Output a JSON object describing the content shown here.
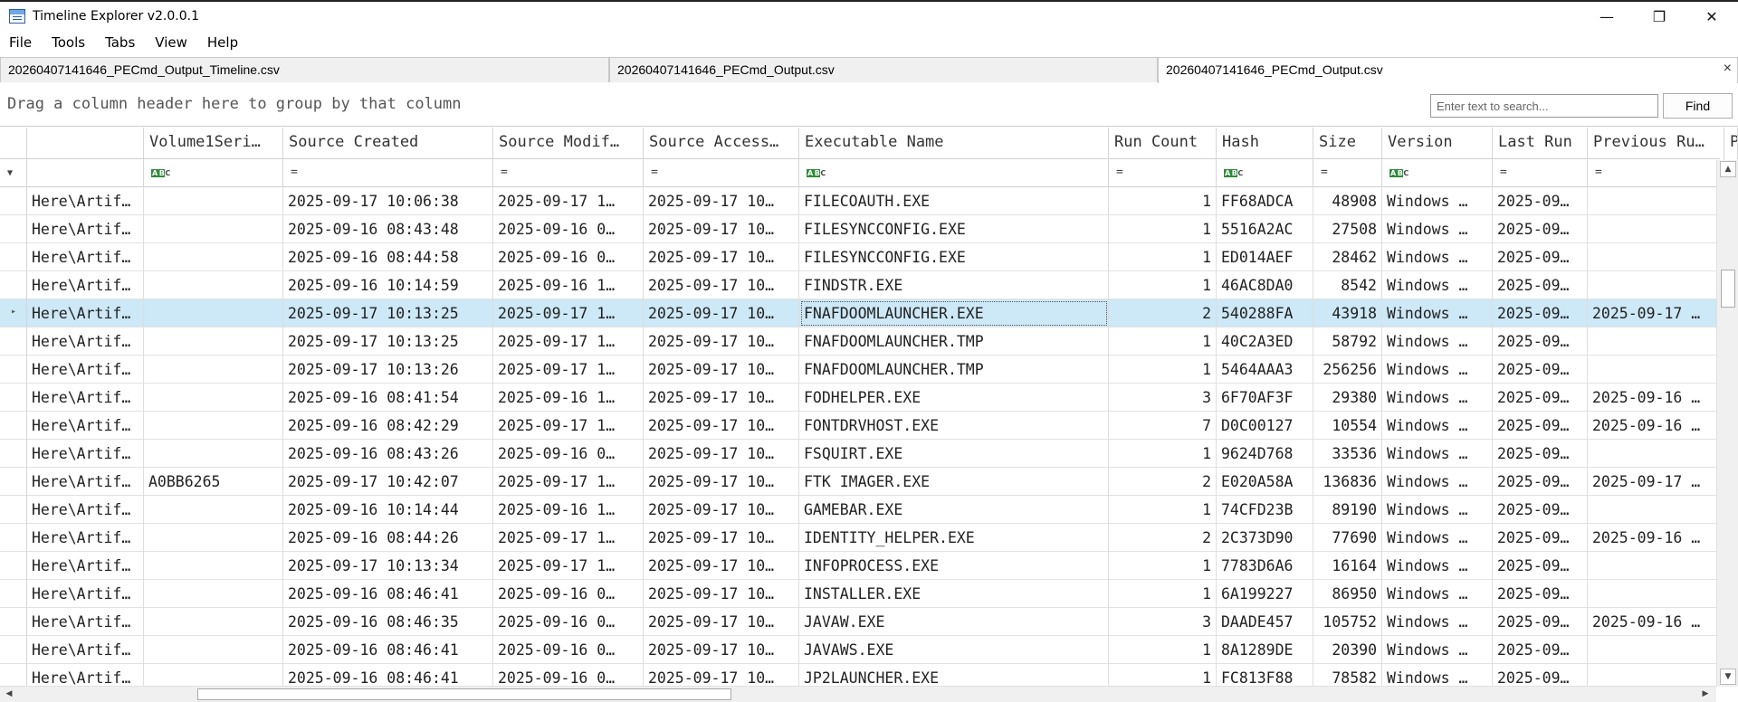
{
  "window": {
    "title": "Timeline Explorer v2.0.0.1",
    "minimize": "—",
    "restore": "❐",
    "close": "✕"
  },
  "menu": [
    "File",
    "Tools",
    "Tabs",
    "View",
    "Help"
  ],
  "tabs": [
    {
      "label": "20260407141646_PECmd_Output_Timeline.csv",
      "active": false
    },
    {
      "label": "20260407141646_PECmd_Output.csv",
      "active": false
    },
    {
      "label": "20260407141646_PECmd_Output.csv",
      "active": true
    }
  ],
  "tab_close": "×",
  "group_panel": {
    "hint": "Drag a column header here to group by that column",
    "search_placeholder": "Enter text to search...",
    "find_label": "Find"
  },
  "columns": [
    {
      "label": "",
      "filter": "",
      "type": "text"
    },
    {
      "label": "Volume1Seri…",
      "filter": "abc",
      "type": "text"
    },
    {
      "label": "Source Created",
      "filter": "=",
      "type": "date"
    },
    {
      "label": "Source Modif…",
      "filter": "=",
      "type": "date"
    },
    {
      "label": "Source Access…",
      "filter": "=",
      "type": "date"
    },
    {
      "label": "Executable Name",
      "filter": "abc",
      "type": "text"
    },
    {
      "label": "Run Count",
      "filter": "=",
      "type": "num"
    },
    {
      "label": "Hash",
      "filter": "abc",
      "type": "text"
    },
    {
      "label": "Size",
      "filter": "=",
      "type": "num"
    },
    {
      "label": "Version",
      "filter": "abc",
      "type": "text"
    },
    {
      "label": "Last Run",
      "filter": "=",
      "type": "date"
    },
    {
      "label": "Previous Ru…",
      "filter": "=",
      "type": "date"
    },
    {
      "label": "P",
      "filter": "",
      "type": "date"
    }
  ],
  "rows": [
    {
      "selected": false,
      "cells": [
        "Here\\Artif…",
        "",
        "2025-09-17 10:06:38",
        "2025-09-17 1…",
        "2025-09-17 10…",
        "FILECOAUTH.EXE",
        "1",
        "FF68ADCA",
        "48908",
        "Windows …",
        "2025-09…",
        "",
        ""
      ]
    },
    {
      "selected": false,
      "cells": [
        "Here\\Artif…",
        "",
        "2025-09-16 08:43:48",
        "2025-09-16 0…",
        "2025-09-17 10…",
        "FILESYNCCONFIG.EXE",
        "1",
        "5516A2AC",
        "27508",
        "Windows …",
        "2025-09…",
        "",
        ""
      ]
    },
    {
      "selected": false,
      "cells": [
        "Here\\Artif…",
        "",
        "2025-09-16 08:44:58",
        "2025-09-16 0…",
        "2025-09-17 10…",
        "FILESYNCCONFIG.EXE",
        "1",
        "ED014AEF",
        "28462",
        "Windows …",
        "2025-09…",
        "",
        ""
      ]
    },
    {
      "selected": false,
      "cells": [
        "Here\\Artif…",
        "",
        "2025-09-16 10:14:59",
        "2025-09-16 1…",
        "2025-09-17 10…",
        "FINDSTR.EXE",
        "1",
        "46AC8DA0",
        "8542",
        "Windows …",
        "2025-09…",
        "",
        ""
      ]
    },
    {
      "selected": true,
      "cells": [
        "Here\\Artif…",
        "",
        "2025-09-17 10:13:25",
        "2025-09-17 1…",
        "2025-09-17 10…",
        "FNAFDOOMLAUNCHER.EXE",
        "2",
        "540288FA",
        "43918",
        "Windows …",
        "2025-09…",
        "2025-09-17 …",
        ""
      ]
    },
    {
      "selected": false,
      "cells": [
        "Here\\Artif…",
        "",
        "2025-09-17 10:13:25",
        "2025-09-17 1…",
        "2025-09-17 10…",
        "FNAFDOOMLAUNCHER.TMP",
        "1",
        "40C2A3ED",
        "58792",
        "Windows …",
        "2025-09…",
        "",
        ""
      ]
    },
    {
      "selected": false,
      "cells": [
        "Here\\Artif…",
        "",
        "2025-09-17 10:13:26",
        "2025-09-17 1…",
        "2025-09-17 10…",
        "FNAFDOOMLAUNCHER.TMP",
        "1",
        "5464AAA3",
        "256256",
        "Windows …",
        "2025-09…",
        "",
        ""
      ]
    },
    {
      "selected": false,
      "cells": [
        "Here\\Artif…",
        "",
        "2025-09-16 08:41:54",
        "2025-09-16 1…",
        "2025-09-17 10…",
        "FODHELPER.EXE",
        "3",
        "6F70AF3F",
        "29380",
        "Windows …",
        "2025-09…",
        "2025-09-16 …",
        ""
      ]
    },
    {
      "selected": false,
      "cells": [
        "Here\\Artif…",
        "",
        "2025-09-16 08:42:29",
        "2025-09-17 1…",
        "2025-09-17 10…",
        "FONTDRVHOST.EXE",
        "7",
        "D0C00127",
        "10554",
        "Windows …",
        "2025-09…",
        "2025-09-16 …",
        ""
      ]
    },
    {
      "selected": false,
      "cells": [
        "Here\\Artif…",
        "",
        "2025-09-16 08:43:26",
        "2025-09-16 0…",
        "2025-09-17 10…",
        "FSQUIRT.EXE",
        "1",
        "9624D768",
        "33536",
        "Windows …",
        "2025-09…",
        "",
        ""
      ]
    },
    {
      "selected": false,
      "cells": [
        "Here\\Artif…",
        "A0BB6265",
        "2025-09-17 10:42:07",
        "2025-09-17 1…",
        "2025-09-17 10…",
        "FTK IMAGER.EXE",
        "2",
        "E020A58A",
        "136836",
        "Windows …",
        "2025-09…",
        "2025-09-17 …",
        ""
      ]
    },
    {
      "selected": false,
      "cells": [
        "Here\\Artif…",
        "",
        "2025-09-16 10:14:44",
        "2025-09-16 1…",
        "2025-09-17 10…",
        "GAMEBAR.EXE",
        "1",
        "74CFD23B",
        "89190",
        "Windows …",
        "2025-09…",
        "",
        ""
      ]
    },
    {
      "selected": false,
      "cells": [
        "Here\\Artif…",
        "",
        "2025-09-16 08:44:26",
        "2025-09-17 1…",
        "2025-09-17 10…",
        "IDENTITY_HELPER.EXE",
        "2",
        "2C373D90",
        "77690",
        "Windows …",
        "2025-09…",
        "2025-09-16 …",
        ""
      ]
    },
    {
      "selected": false,
      "cells": [
        "Here\\Artif…",
        "",
        "2025-09-17 10:13:34",
        "2025-09-17 1…",
        "2025-09-17 10…",
        "INFOPROCESS.EXE",
        "1",
        "7783D6A6",
        "16164",
        "Windows …",
        "2025-09…",
        "",
        ""
      ]
    },
    {
      "selected": false,
      "cells": [
        "Here\\Artif…",
        "",
        "2025-09-16 08:46:41",
        "2025-09-16 0…",
        "2025-09-17 10…",
        "INSTALLER.EXE",
        "1",
        "6A199227",
        "86950",
        "Windows …",
        "2025-09…",
        "",
        ""
      ]
    },
    {
      "selected": false,
      "cells": [
        "Here\\Artif…",
        "",
        "2025-09-16 08:46:35",
        "2025-09-16 0…",
        "2025-09-17 10…",
        "JAVAW.EXE",
        "3",
        "DAADE457",
        "105752",
        "Windows …",
        "2025-09…",
        "2025-09-16 …",
        ""
      ]
    },
    {
      "selected": false,
      "cells": [
        "Here\\Artif…",
        "",
        "2025-09-16 08:46:41",
        "2025-09-16 0…",
        "2025-09-17 10…",
        "JAVAWS.EXE",
        "1",
        "8A1289DE",
        "20390",
        "Windows …",
        "2025-09…",
        "",
        ""
      ]
    },
    {
      "selected": false,
      "cells": [
        "Here\\Artif…",
        "",
        "2025-09-16 08:46:41",
        "2025-09-16 0…",
        "2025-09-17 10…",
        "JP2LAUNCHER.EXE",
        "1",
        "FC813F88",
        "78582",
        "Windows …",
        "2025-09…",
        "",
        ""
      ]
    }
  ],
  "scroll_arrows": {
    "up": "▲",
    "down": "▼",
    "left": "◀",
    "right": "▶"
  },
  "colors": {
    "selection": "#cde8f6",
    "grid_line": "#dedede",
    "abc_badge": "#2e8b3a"
  }
}
